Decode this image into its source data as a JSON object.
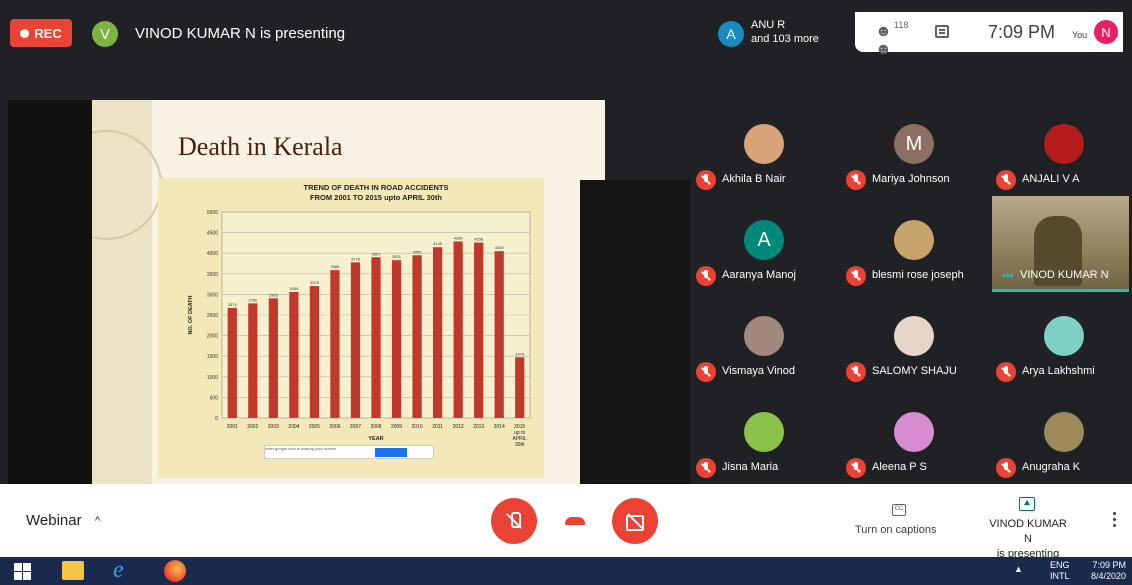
{
  "topbar": {
    "rec_label": "REC",
    "presenter_initial": "V",
    "presenter_text": "VINOD KUMAR N is presenting",
    "anu_initial": "A",
    "anu_name": "ANU R",
    "anu_more": "and 103 more",
    "people_count": "118",
    "clock": "7:09 PM",
    "you_label": "You",
    "you_initial": "N"
  },
  "slide": {
    "title": "Death in Kerala",
    "share_banner": "meet.google.com is sharing your screen"
  },
  "chart_data": {
    "type": "bar",
    "title": "TREND OF DEATH IN ROAD ACCIDENTS",
    "subtitle": "FROM 2001 TO  2015 upto  APRIL 30th",
    "xlabel": "YEAR",
    "ylabel": "NO. OF DEATH",
    "ylim": [
      0,
      5000
    ],
    "yticks": [
      0,
      500,
      1000,
      1500,
      2000,
      2500,
      3000,
      3500,
      4000,
      4500,
      5000
    ],
    "categories": [
      "2001",
      "2002",
      "2003",
      "2004",
      "2005",
      "2006",
      "2007",
      "2008",
      "2009",
      "2010",
      "2011",
      "2012",
      "2013",
      "2014",
      "2015 up to APRIL 30th"
    ],
    "values": [
      2674,
      2782,
      2905,
      3059,
      3203,
      3589,
      3778,
      3901,
      3831,
      3950,
      4145,
      4286,
      4258,
      4049,
      1474
    ],
    "color": "#c0392b",
    "grid": true
  },
  "participants": [
    {
      "name": "Akhila B Nair",
      "initial": "",
      "color": "#d9a37a"
    },
    {
      "name": "Mariya Johnson",
      "initial": "M",
      "color": "#8d6e63"
    },
    {
      "name": "ANJALI V A",
      "initial": "",
      "color": "#b71c1c"
    },
    {
      "name": "Aaranya Manoj",
      "initial": "A",
      "color": "#00897b"
    },
    {
      "name": "blesmi rose joseph",
      "initial": "",
      "color": "#c7a46b"
    },
    {
      "name": "Vismaya Vinod",
      "initial": "",
      "color": "#a1887f"
    },
    {
      "name": "SALOMY SHAJU",
      "initial": "",
      "color": "#e6d6c9"
    },
    {
      "name": "Arya Lakhshmi",
      "initial": "",
      "color": "#7fd1c4"
    },
    {
      "name": "Jisna Maria",
      "initial": "",
      "color": "#8bc34a"
    },
    {
      "name": "Aleena P S",
      "initial": "",
      "color": "#d78bd1"
    },
    {
      "name": "Anugraha K",
      "initial": "",
      "color": "#9e8b5b"
    }
  ],
  "video_tile": {
    "name": "VINOD KUMAR N",
    "dots": "•••"
  },
  "bottombar": {
    "meeting_name": "Webinar",
    "chevron": "^",
    "captions_icon": "CC",
    "captions_label": "Turn on captions",
    "present_line1": "VINOD KUMAR N",
    "present_line2": "is presenting"
  },
  "taskbar": {
    "tray_arrow": "▲",
    "lang1": "ENG",
    "lang2": "INTL",
    "time": "7:09 PM",
    "date": "8/4/2020"
  }
}
